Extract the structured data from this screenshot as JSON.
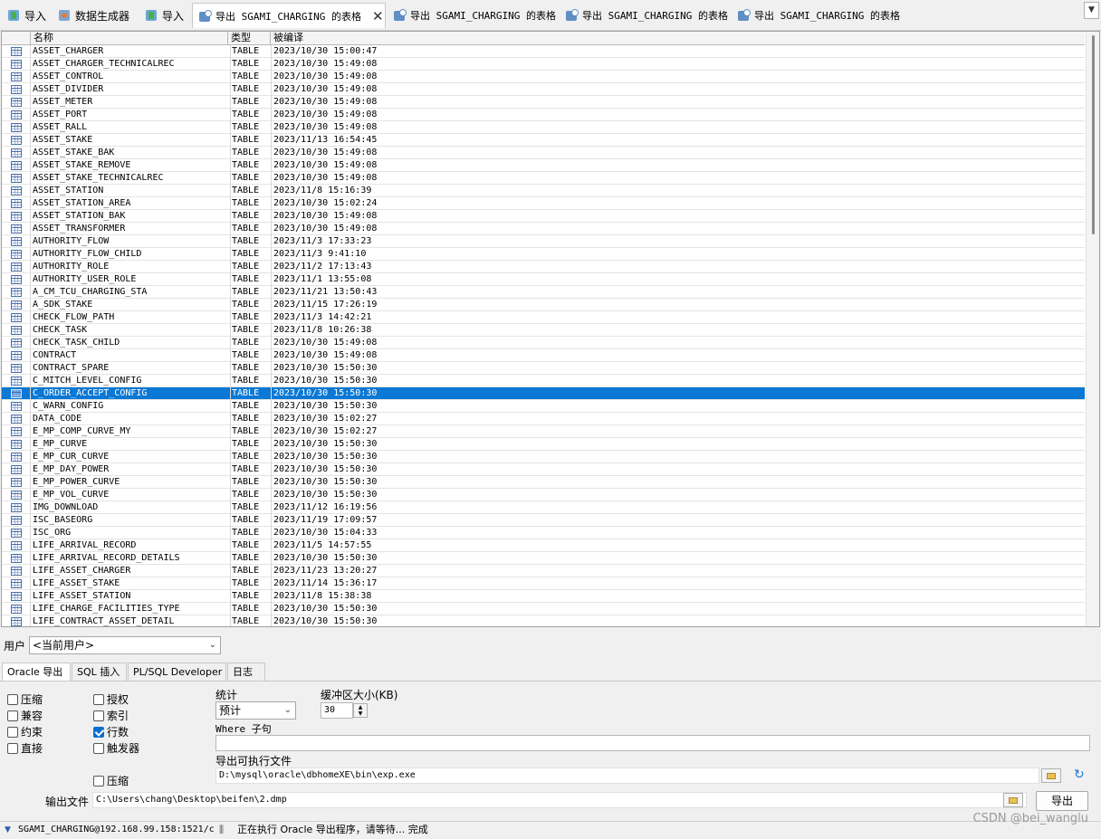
{
  "tabs": [
    {
      "label": "导入",
      "icon": "import-icon"
    },
    {
      "label": "数据生成器",
      "icon": "data-generator-icon"
    },
    {
      "label": "导入",
      "icon": "import-icon"
    },
    {
      "label": "导出 SGAMI_CHARGING 的表格",
      "icon": "export-icon",
      "active": true
    },
    {
      "label": "导出 SGAMI_CHARGING 的表格",
      "icon": "export-icon"
    },
    {
      "label": "导出 SGAMI_CHARGING 的表格",
      "icon": "export-icon"
    },
    {
      "label": "导出 SGAMI_CHARGING 的表格",
      "icon": "export-icon"
    }
  ],
  "tab_close": "✕",
  "tab_dropdown": "▼",
  "grid": {
    "columns": [
      "名称",
      "类型",
      "被编译"
    ],
    "selected_index": 27,
    "rows": [
      [
        "ASSET_CHARGER",
        "TABLE",
        "2023/10/30 15:00:47"
      ],
      [
        "ASSET_CHARGER_TECHNICALREC",
        "TABLE",
        "2023/10/30 15:49:08"
      ],
      [
        "ASSET_CONTROL",
        "TABLE",
        "2023/10/30 15:49:08"
      ],
      [
        "ASSET_DIVIDER",
        "TABLE",
        "2023/10/30 15:49:08"
      ],
      [
        "ASSET_METER",
        "TABLE",
        "2023/10/30 15:49:08"
      ],
      [
        "ASSET_PORT",
        "TABLE",
        "2023/10/30 15:49:08"
      ],
      [
        "ASSET_RALL",
        "TABLE",
        "2023/10/30 15:49:08"
      ],
      [
        "ASSET_STAKE",
        "TABLE",
        "2023/11/13 16:54:45"
      ],
      [
        "ASSET_STAKE_BAK",
        "TABLE",
        "2023/10/30 15:49:08"
      ],
      [
        "ASSET_STAKE_REMOVE",
        "TABLE",
        "2023/10/30 15:49:08"
      ],
      [
        "ASSET_STAKE_TECHNICALREC",
        "TABLE",
        "2023/10/30 15:49:08"
      ],
      [
        "ASSET_STATION",
        "TABLE",
        "2023/11/8 15:16:39"
      ],
      [
        "ASSET_STATION_AREA",
        "TABLE",
        "2023/10/30 15:02:24"
      ],
      [
        "ASSET_STATION_BAK",
        "TABLE",
        "2023/10/30 15:49:08"
      ],
      [
        "ASSET_TRANSFORMER",
        "TABLE",
        "2023/10/30 15:49:08"
      ],
      [
        "AUTHORITY_FLOW",
        "TABLE",
        "2023/11/3 17:33:23"
      ],
      [
        "AUTHORITY_FLOW_CHILD",
        "TABLE",
        "2023/11/3 9:41:10"
      ],
      [
        "AUTHORITY_ROLE",
        "TABLE",
        "2023/11/2 17:13:43"
      ],
      [
        "AUTHORITY_USER_ROLE",
        "TABLE",
        "2023/11/1 13:55:08"
      ],
      [
        "A_CM_TCU_CHARGING_STA",
        "TABLE",
        "2023/11/21 13:50:43"
      ],
      [
        "A_SDK_STAKE",
        "TABLE",
        "2023/11/15 17:26:19"
      ],
      [
        "CHECK_FLOW_PATH",
        "TABLE",
        "2023/11/3 14:42:21"
      ],
      [
        "CHECK_TASK",
        "TABLE",
        "2023/11/8 10:26:38"
      ],
      [
        "CHECK_TASK_CHILD",
        "TABLE",
        "2023/10/30 15:49:08"
      ],
      [
        "CONTRACT",
        "TABLE",
        "2023/10/30 15:49:08"
      ],
      [
        "CONTRACT_SPARE",
        "TABLE",
        "2023/10/30 15:50:30"
      ],
      [
        "C_MITCH_LEVEL_CONFIG",
        "TABLE",
        "2023/10/30 15:50:30"
      ],
      [
        "C_ORDER_ACCEPT_CONFIG",
        "TABLE",
        "2023/10/30 15:50:30"
      ],
      [
        "C_WARN_CONFIG",
        "TABLE",
        "2023/10/30 15:50:30"
      ],
      [
        "DATA_CODE",
        "TABLE",
        "2023/10/30 15:02:27"
      ],
      [
        "E_MP_COMP_CURVE_MY",
        "TABLE",
        "2023/10/30 15:02:27"
      ],
      [
        "E_MP_CURVE",
        "TABLE",
        "2023/10/30 15:50:30"
      ],
      [
        "E_MP_CUR_CURVE",
        "TABLE",
        "2023/10/30 15:50:30"
      ],
      [
        "E_MP_DAY_POWER",
        "TABLE",
        "2023/10/30 15:50:30"
      ],
      [
        "E_MP_POWER_CURVE",
        "TABLE",
        "2023/10/30 15:50:30"
      ],
      [
        "E_MP_VOL_CURVE",
        "TABLE",
        "2023/10/30 15:50:30"
      ],
      [
        "IMG_DOWNLOAD",
        "TABLE",
        "2023/11/12 16:19:56"
      ],
      [
        "ISC_BASEORG",
        "TABLE",
        "2023/11/19 17:09:57"
      ],
      [
        "ISC_ORG",
        "TABLE",
        "2023/10/30 15:04:33"
      ],
      [
        "LIFE_ARRIVAL_RECORD",
        "TABLE",
        "2023/11/5 14:57:55"
      ],
      [
        "LIFE_ARRIVAL_RECORD_DETAILS",
        "TABLE",
        "2023/10/30 15:50:30"
      ],
      [
        "LIFE_ASSET_CHARGER",
        "TABLE",
        "2023/11/23 13:20:27"
      ],
      [
        "LIFE_ASSET_STAKE",
        "TABLE",
        "2023/11/14 15:36:17"
      ],
      [
        "LIFE_ASSET_STATION",
        "TABLE",
        "2023/11/8 15:38:38"
      ],
      [
        "LIFE_CHARGE_FACILITIES_TYPE",
        "TABLE",
        "2023/10/30 15:50:30"
      ],
      [
        "LIFE_CONTRACT_ASSET_DETAIL",
        "TABLE",
        "2023/10/30 15:50:30"
      ]
    ]
  },
  "user": {
    "label": "用户",
    "value": "<当前用户>"
  },
  "subtabs": [
    "Oracle 导出",
    "SQL 插入",
    "PL/SQL Developer",
    "日志"
  ],
  "options": {
    "compress": {
      "label": "压缩",
      "checked": false
    },
    "compatible": {
      "label": "兼容",
      "checked": false
    },
    "constraints": {
      "label": "约束",
      "checked": false
    },
    "direct": {
      "label": "直接",
      "checked": false
    },
    "grants": {
      "label": "授权",
      "checked": false
    },
    "indexes": {
      "label": "索引",
      "checked": false
    },
    "rows": {
      "label": "行数",
      "checked": true
    },
    "triggers": {
      "label": "触发器",
      "checked": false
    },
    "compress2": {
      "label": "压缩",
      "checked": false
    }
  },
  "statistics": {
    "label": "统计",
    "value": "预计"
  },
  "buffer": {
    "label": "缓冲区大小(KB)",
    "value": "30"
  },
  "where": {
    "label": "Where 子句",
    "value": ""
  },
  "executable": {
    "label": "导出可执行文件",
    "value": "D:\\mysql\\oracle\\dbhomeXE\\bin\\exp.exe"
  },
  "output": {
    "label": "输出文件",
    "value": "C:\\Users\\chang\\Desktop\\beifen\\2.dmp"
  },
  "export_button": "导出",
  "status": {
    "connection": "SGAMI_CHARGING@192.168.99.158:1521/c",
    "message": "正在执行 Oracle 导出程序，请等待... 完成"
  },
  "watermark": "CSDN @bei_wanglu",
  "colors": {
    "selection": "#0a78d4",
    "checkbox_checked": "#0a6fd1"
  }
}
